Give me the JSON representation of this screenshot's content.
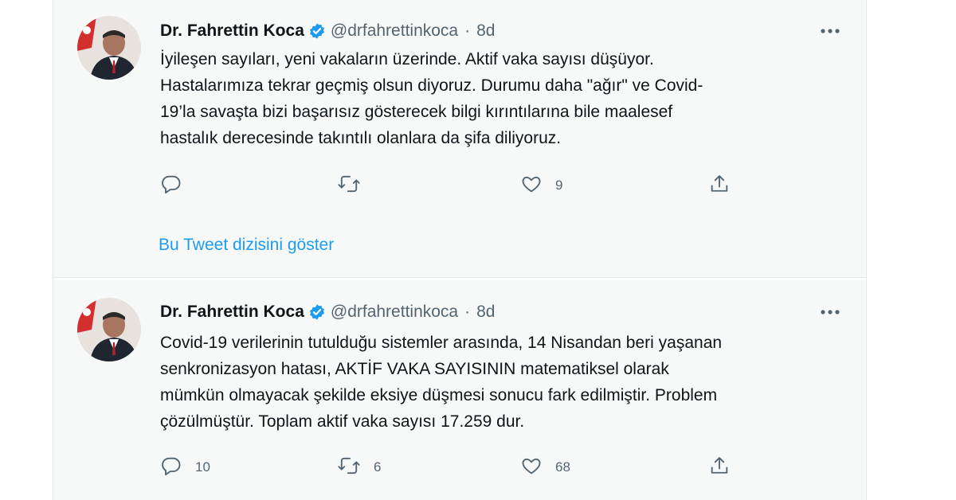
{
  "colors": {
    "link": "#1d9bf0",
    "verified": "#1d9bf0",
    "muted": "#536471",
    "tweet_bg": "#f7f9f9"
  },
  "tweets": [
    {
      "author": {
        "name": "Dr. Fahrettin Koca",
        "handle": "@drfahrettinkoca",
        "time": "8d",
        "verified_icon": "verified-badge-icon",
        "avatar_icon": "profile-photo"
      },
      "text_lines": [
        "İyileşen sayıları, yeni vakaların üzerinde. Aktif vaka sayısı düşüyor.",
        "Hastalarımıza tekrar geçmiş olsun diyoruz. Durumu daha \"ağır\" ve Covid-",
        "19’la savaşta bizi başarısız gösterecek bilgi kırıntılarına bile maalesef",
        "hastalık derecesinde takıntılı olanlara da şifa diliyoruz."
      ],
      "actions": {
        "reply_count": "",
        "retweet_count": "",
        "like_count": "9",
        "icons": [
          "reply-icon",
          "retweet-icon",
          "like-icon",
          "share-icon"
        ]
      },
      "thread_link": "Bu Tweet dizisini göster"
    },
    {
      "author": {
        "name": "Dr. Fahrettin Koca",
        "handle": "@drfahrettinkoca",
        "time": "8d",
        "verified_icon": "verified-badge-icon",
        "avatar_icon": "profile-photo"
      },
      "text_lines": [
        "Covid-19 verilerinin tutulduğu sistemler arasında, 14 Nisandan beri yaşanan",
        "senkronizasyon hatası, AKTİF VAKA SAYISININ matematiksel olarak",
        "mümkün olmayacak şekilde eksiye düşmesi sonucu fark edilmiştir. Problem",
        "çözülmüştür. Toplam aktif vaka sayısı 17.259 dur."
      ],
      "actions": {
        "reply_count": "10",
        "retweet_count": "6",
        "like_count": "68",
        "icons": [
          "reply-icon",
          "retweet-icon",
          "like-icon",
          "share-icon"
        ]
      }
    }
  ],
  "more_icon": "more-options-icon"
}
